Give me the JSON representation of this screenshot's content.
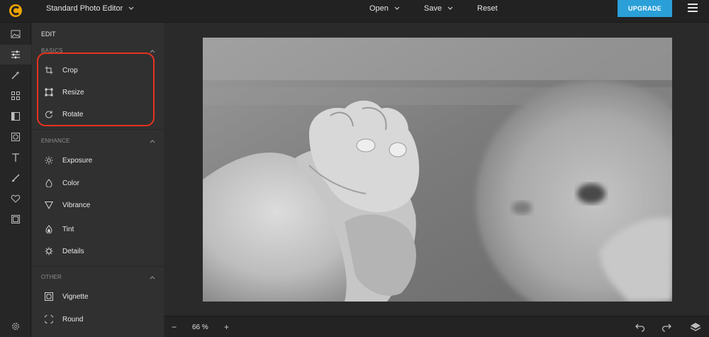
{
  "header": {
    "app_name": "Standard Photo Editor",
    "menu": {
      "open": "Open",
      "save": "Save",
      "reset": "Reset"
    },
    "upgrade_label": "UPGRADE",
    "brand_color": "#f0a500",
    "accent_color": "#2a9fd8"
  },
  "rail": {
    "items": [
      "image-icon",
      "sliders-icon",
      "wand-icon",
      "grid-icon",
      "frame-icon",
      "vignette-icon",
      "text-icon",
      "brush-icon",
      "heart-icon",
      "border-icon"
    ],
    "active": "sliders-icon",
    "settings_icon": "gear-icon"
  },
  "panel": {
    "title": "EDIT",
    "basics": {
      "label": "BASICS",
      "tools": [
        {
          "label": "Crop",
          "icon": "crop-icon"
        },
        {
          "label": "Resize",
          "icon": "resize-icon"
        },
        {
          "label": "Rotate",
          "icon": "rotate-icon"
        }
      ]
    },
    "enhance": {
      "label": "ENHANCE",
      "tools": [
        {
          "label": "Exposure",
          "icon": "sun-icon"
        },
        {
          "label": "Color",
          "icon": "droplet-icon"
        },
        {
          "label": "Vibrance",
          "icon": "triangle-icon"
        },
        {
          "label": "Tint",
          "icon": "tint-icon"
        },
        {
          "label": "Details",
          "icon": "details-icon"
        }
      ]
    },
    "other": {
      "label": "OTHER",
      "tools": [
        {
          "label": "Vignette",
          "icon": "vignette-icon"
        },
        {
          "label": "Round",
          "icon": "round-corners-icon"
        }
      ]
    },
    "highlight_color": "#e8321e"
  },
  "footer": {
    "zoom_out": "−",
    "zoom_level": "66 %",
    "zoom_in": "+",
    "undo_icon": "undo-icon",
    "redo_icon": "redo-icon",
    "layers_icon": "layers-icon"
  }
}
